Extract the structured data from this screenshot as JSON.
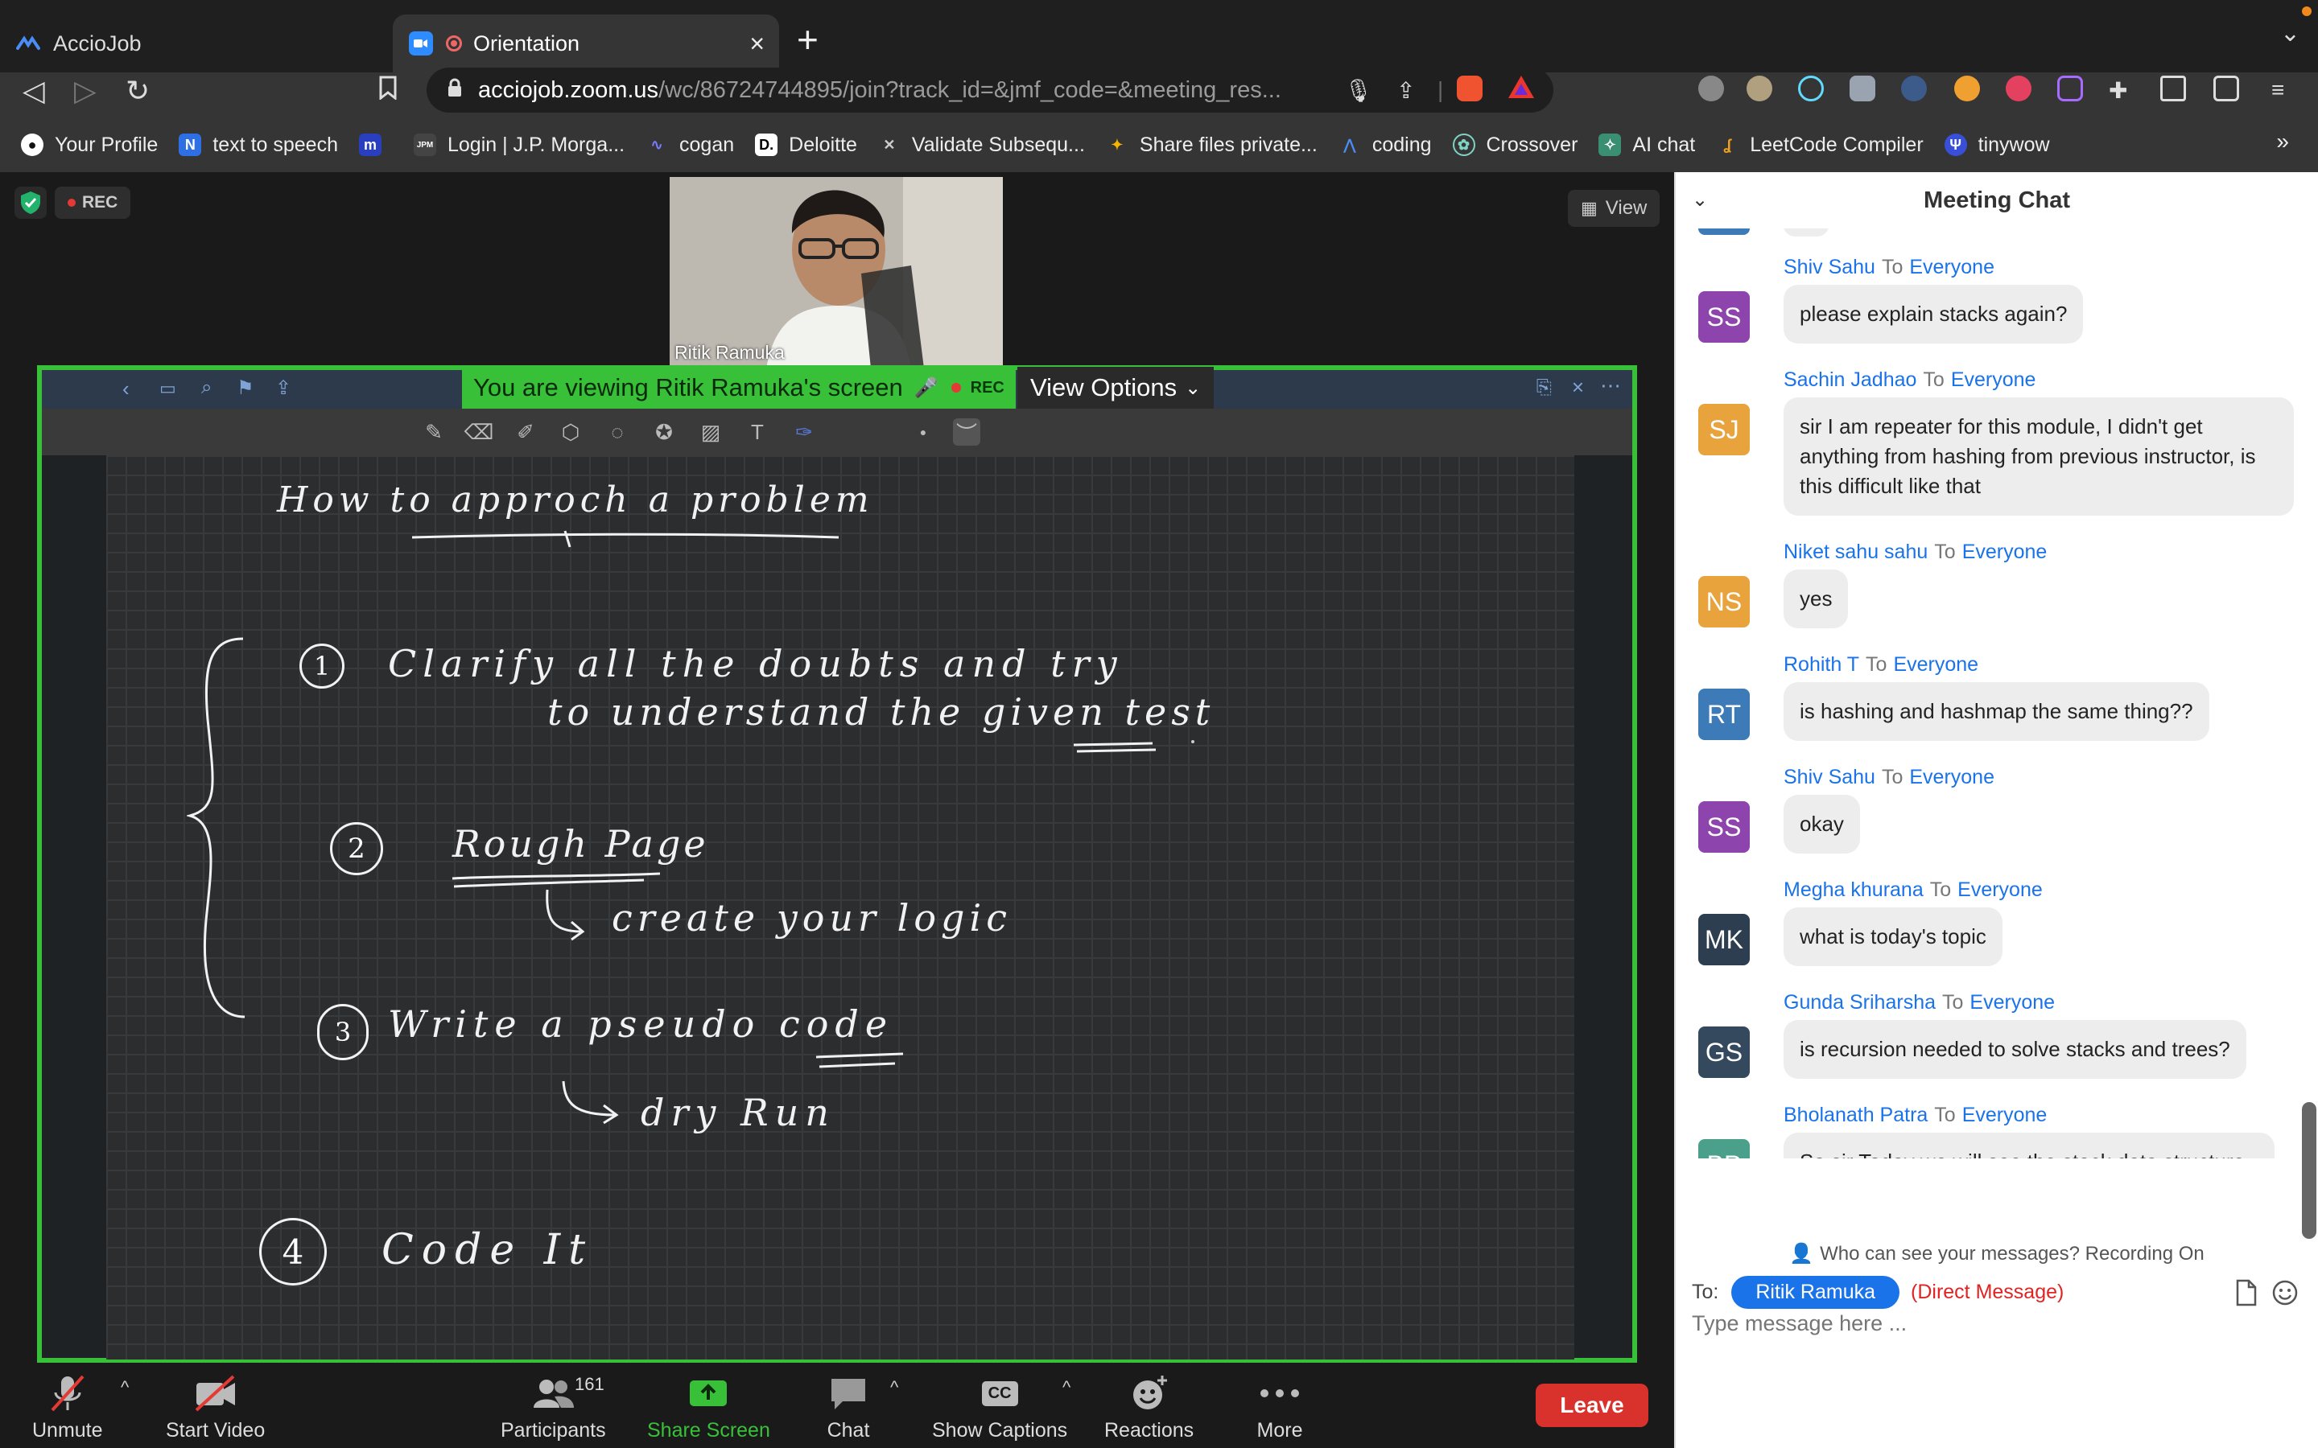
{
  "browser": {
    "tabs": [
      {
        "title": "AccioJob",
        "active": false
      },
      {
        "title": "Orientation",
        "active": true
      }
    ],
    "url_host": "acciojob.zoom.us",
    "url_rest": "/wc/86724744895/join?track_id=&jmf_code=&meeting_res...",
    "bookmarks": [
      {
        "label": "Your Profile",
        "icon": "github-icon"
      },
      {
        "label": "text to speech",
        "icon": "n-icon"
      },
      {
        "label": "",
        "icon": "m-icon"
      },
      {
        "label": "Login | J.P. Morga...",
        "icon": "jpm-icon"
      },
      {
        "label": "cogan",
        "icon": "cogan-icon"
      },
      {
        "label": "Deloitte",
        "icon": "deloitte-icon"
      },
      {
        "label": "Validate Subsequ...",
        "icon": "validate-icon"
      },
      {
        "label": "Share files private...",
        "icon": "share-files-icon"
      },
      {
        "label": "coding",
        "icon": "coding-icon"
      },
      {
        "label": "Crossover",
        "icon": "crossover-icon"
      },
      {
        "label": "AI chat",
        "icon": "ai-chat-icon"
      },
      {
        "label": "LeetCode Compiler",
        "icon": "leetcode-icon"
      },
      {
        "label": "tinywow",
        "icon": "tinywow-icon"
      }
    ]
  },
  "meeting": {
    "rec_label": "REC",
    "view_label": "View",
    "video_name": "Ritik Ramuka",
    "share_banner": "You are viewing Ritik Ramuka's screen",
    "share_rec": "REC",
    "view_options": "View Options"
  },
  "whiteboard": {
    "title": "How to approch a problem",
    "steps": [
      {
        "num": "1",
        "line1": "Clarify all the doubts and try",
        "line2": "to understand the given test"
      },
      {
        "num": "2",
        "line1": "Rough Page",
        "line2": "create your logic"
      },
      {
        "num": "3",
        "line1": "Write a pseudo code",
        "line2": "dry Run"
      },
      {
        "num": "4",
        "line1": "Code It",
        "line2": ""
      }
    ]
  },
  "controls": {
    "unmute": "Unmute",
    "start_video": "Start Video",
    "participants": "Participants",
    "participants_count": "161",
    "share_screen": "Share Screen",
    "chat": "Chat",
    "show_captions": "Show Captions",
    "captions_badge": "CC",
    "reactions": "Reactions",
    "more": "More",
    "leave": "Leave"
  },
  "chat": {
    "title": "Meeting Chat",
    "to_word": "To",
    "messages": [
      {
        "sender": "Shiv Sahu",
        "to": "Everyone",
        "initials": "SS",
        "color": "#8e44ad",
        "text": "please explain stacks again?"
      },
      {
        "sender": "Sachin Jadhao",
        "to": "Everyone",
        "initials": "SJ",
        "color": "#e8a33d",
        "text": "sir I am repeater for this module, I didn't get anything from hashing from previous instructor, is this difficult like that"
      },
      {
        "sender": "Niket sahu sahu",
        "to": "Everyone",
        "initials": "NS",
        "color": "#e8a33d",
        "text": "yes"
      },
      {
        "sender": "Rohith T",
        "to": "Everyone",
        "initials": "RT",
        "color": "#3d7ab8",
        "text": "is hashing and hashmap the same thing??"
      },
      {
        "sender": "Shiv Sahu",
        "to": "Everyone",
        "initials": "SS",
        "color": "#8e44ad",
        "text": "okay"
      },
      {
        "sender": "Megha khurana",
        "to": "Everyone",
        "initials": "MK",
        "color": "#2c3e50",
        "text": "what is today's topic"
      },
      {
        "sender": "Gunda Sriharsha",
        "to": "Everyone",
        "initials": "GS",
        "color": "#34495e",
        "text": "is recursion needed to solve stacks and trees?"
      },
      {
        "sender": "Bholanath Patra",
        "to": "Everyone",
        "initials": "BP",
        "color": "#4aa08a",
        "text": "So sir Today we will see the stack data structure concept and tomorrow we can relate the things.."
      }
    ],
    "who_can_see": "Who can see your messages? Recording On",
    "to_label": "To:",
    "recipient": "Ritik Ramuka",
    "direct_message": "(Direct Message)",
    "input_placeholder": "Type message here ..."
  }
}
